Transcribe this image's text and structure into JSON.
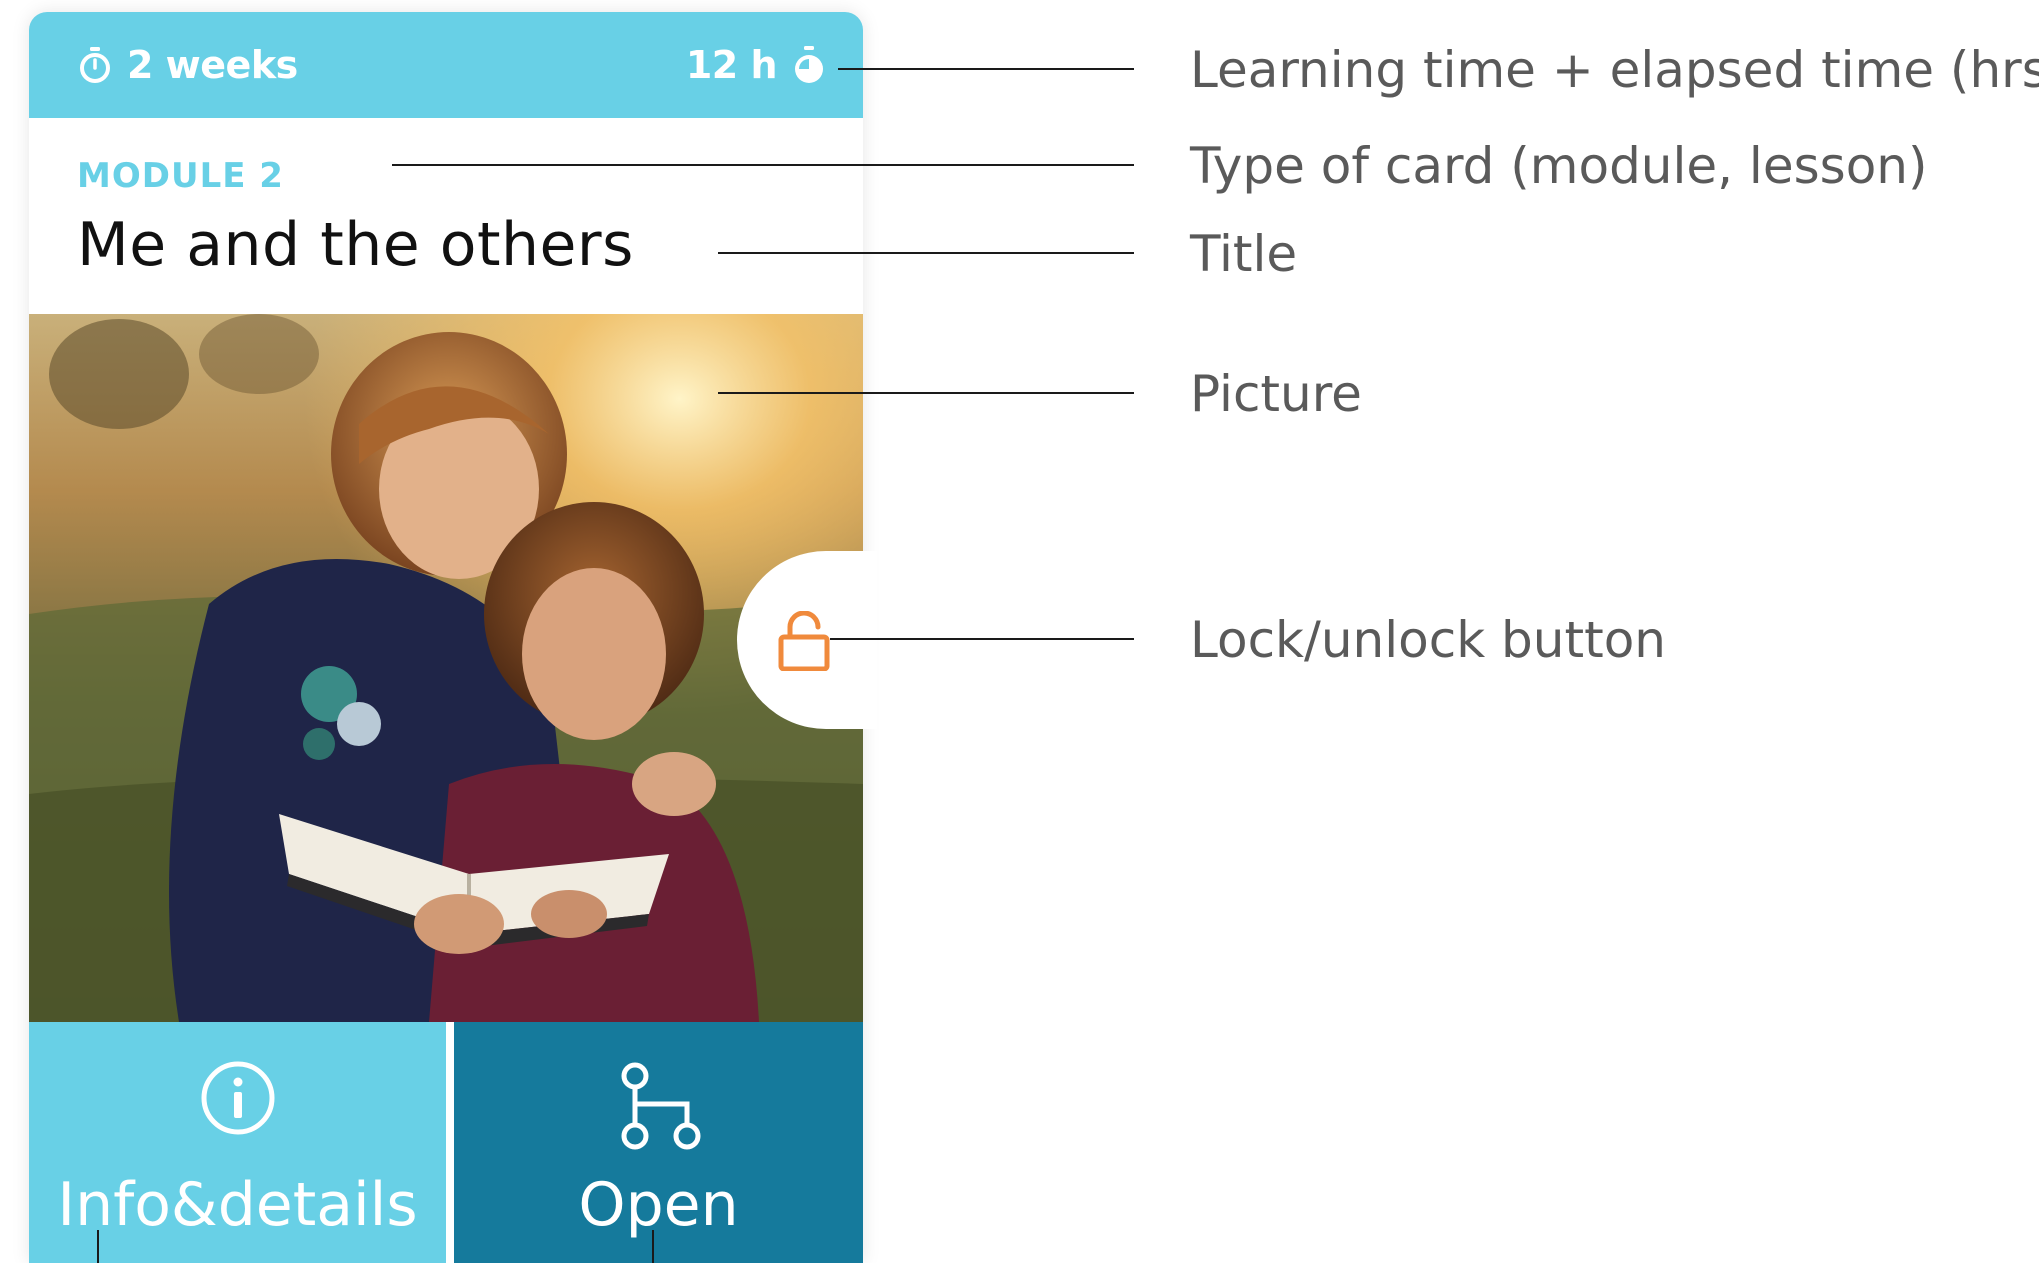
{
  "card": {
    "learning_time": "2 weeks",
    "elapsed_time": "12 h",
    "type_label": "MODULE 2",
    "title": "Me and the others",
    "picture_icon": "photo-two-children-reading-book",
    "lock_icon": "padlock-icon",
    "actions": {
      "info_label": "Info&details",
      "info_icon": "info-circle-icon",
      "open_label": "Open",
      "open_icon": "branch-nodes-icon"
    }
  },
  "annotations": {
    "time": "Learning time + elapsed time (hrs)",
    "type": "Type of card (module, lesson)",
    "title": "Title",
    "picture": "Picture",
    "lock": "Lock/unlock button"
  },
  "colors": {
    "accent_light": "#68d0e6",
    "accent_dark": "#157a9c",
    "lock": "#f08a3c",
    "annotation_text": "#5a5a5a"
  }
}
